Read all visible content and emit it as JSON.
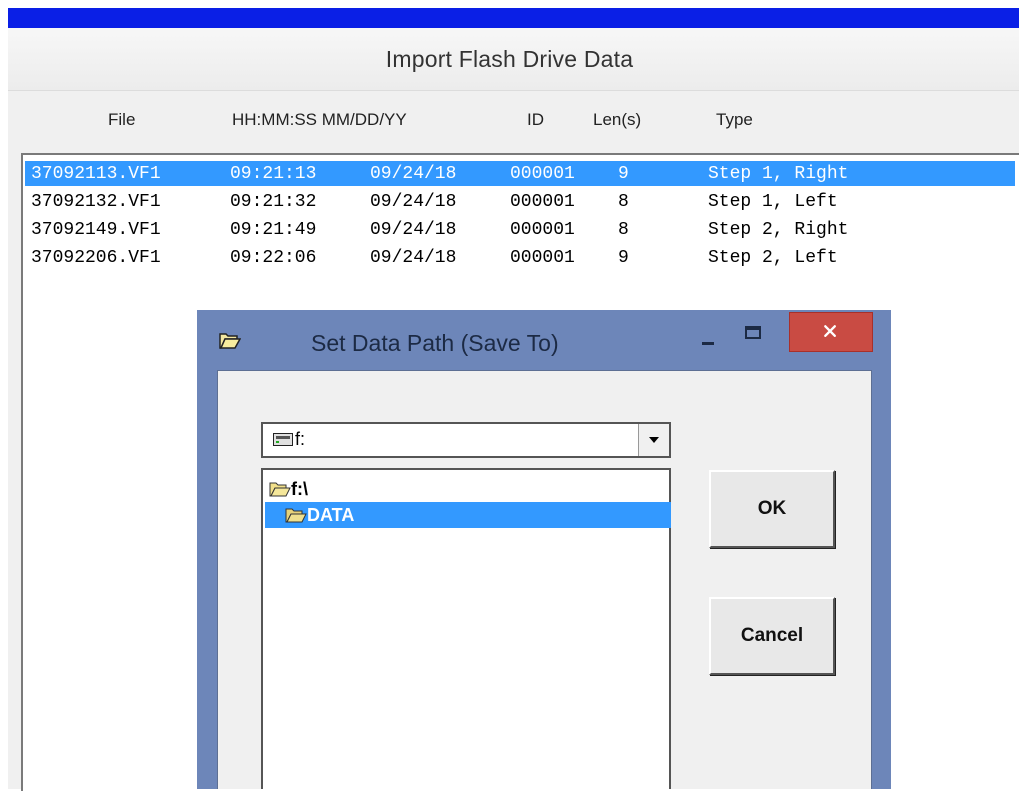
{
  "window": {
    "title": "Import Flash Drive Data"
  },
  "columns": [
    "File",
    "HH:MM:SS MM/DD/YY",
    "ID",
    "Len(s)",
    "Type"
  ],
  "files": [
    {
      "file": "37092113.VF1",
      "time": "09:21:13",
      "date": "09/24/18",
      "id": "000001",
      "len": "9",
      "type": "Step 1, Right",
      "selected": true
    },
    {
      "file": "37092132.VF1",
      "time": "09:21:32",
      "date": "09/24/18",
      "id": "000001",
      "len": "8",
      "type": "Step 1, Left",
      "selected": false
    },
    {
      "file": "37092149.VF1",
      "time": "09:21:49",
      "date": "09/24/18",
      "id": "000001",
      "len": "8",
      "type": "Step 2, Right",
      "selected": false
    },
    {
      "file": "37092206.VF1",
      "time": "09:22:06",
      "date": "09/24/18",
      "id": "000001",
      "len": "9",
      "type": "Step 2, Left",
      "selected": false
    }
  ],
  "dialog": {
    "title": "Set Data Path (Save To)",
    "drive": "f:",
    "tree": {
      "root": "f:\\",
      "selected_folder": "DATA"
    },
    "ok_label": "OK",
    "cancel_label": "Cancel",
    "close_glyph": "×"
  },
  "colors": {
    "selection": "#3399ff",
    "title_bar_accent": "#0a1fe6",
    "dialog_frame": "#6d86b9",
    "close_button": "#c94b43"
  },
  "icons": [
    "folder-open-icon",
    "minimize-icon",
    "maximize-icon",
    "close-icon",
    "drive-icon",
    "dropdown-arrow-icon",
    "folder-icon"
  ]
}
